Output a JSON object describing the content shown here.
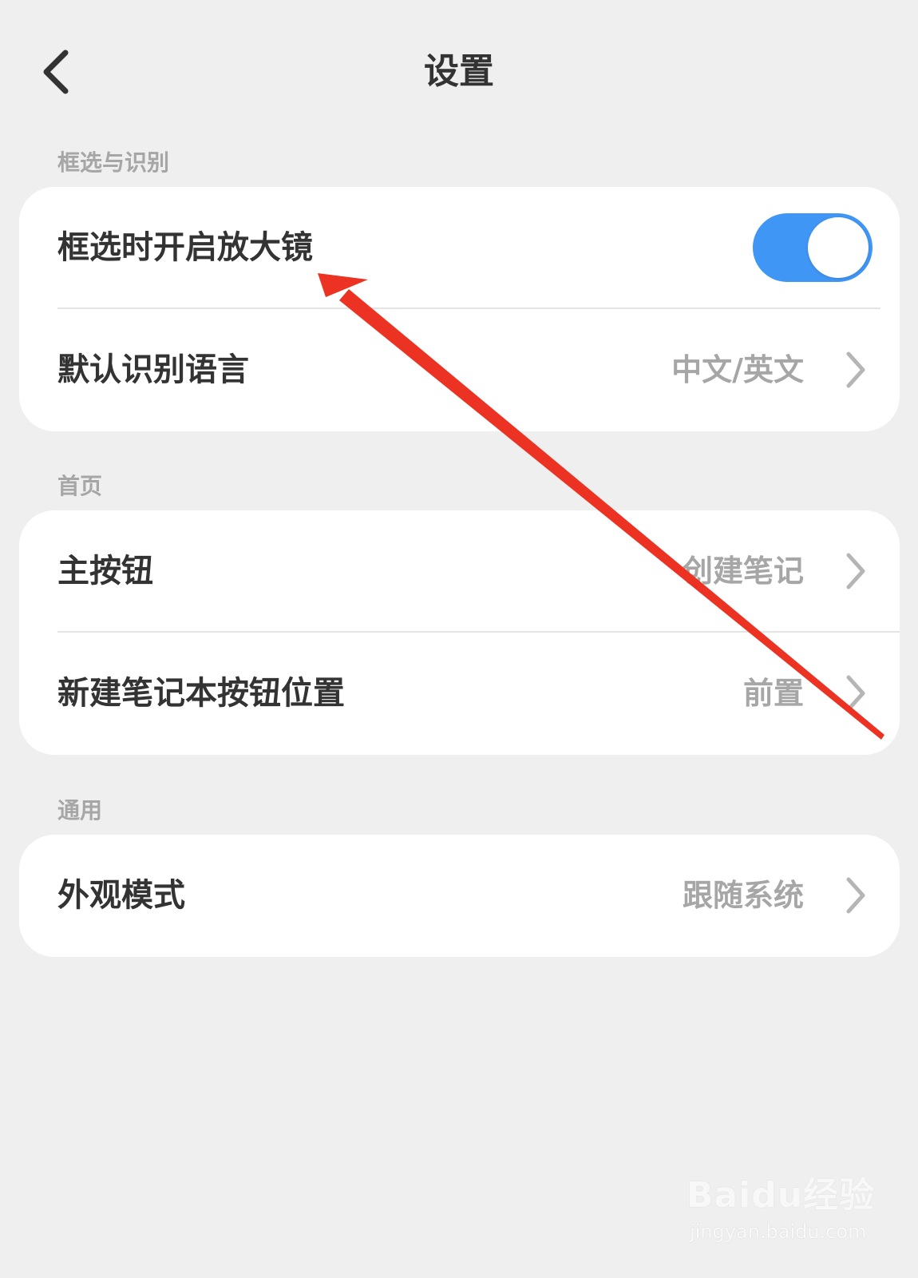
{
  "header": {
    "title": "设置"
  },
  "sections": [
    {
      "label": "框选与识别",
      "rows": [
        {
          "label": "框选时开启放大镜",
          "toggle_on": true
        },
        {
          "label": "默认识别语言",
          "value": "中文/英文"
        }
      ]
    },
    {
      "label": "首页",
      "rows": [
        {
          "label": "主按钮",
          "value": "创建笔记"
        },
        {
          "label": "新建笔记本按钮位置",
          "value": "前置"
        }
      ]
    },
    {
      "label": "通用",
      "rows": [
        {
          "label": "外观模式",
          "value": "跟随系统"
        }
      ]
    }
  ],
  "colors": {
    "toggle_on": "#4096f4",
    "annotation_arrow": "#ec3323",
    "background": "#efefef",
    "card": "#ffffff"
  },
  "icons": {
    "back": "chevron-left-icon",
    "row_arrow": "chevron-right-icon"
  },
  "watermark": {
    "logo": "Baidu经验",
    "url": "jingyan.baidu.com"
  }
}
